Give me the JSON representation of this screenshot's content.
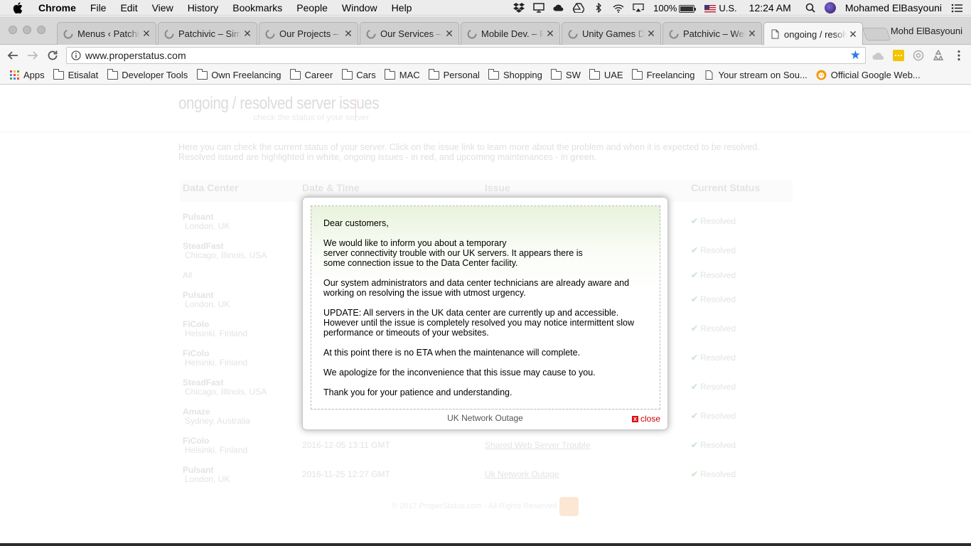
{
  "menubar": {
    "app_name": "Chrome",
    "menus": [
      "File",
      "Edit",
      "View",
      "History",
      "Bookmarks",
      "People",
      "Window",
      "Help"
    ],
    "battery": "100%",
    "input_source": "U.S.",
    "clock": "12:24 AM",
    "user_name": "Mohamed ElBasyouni"
  },
  "tabs": [
    {
      "label": "Menus ‹ Patchi"
    },
    {
      "label": "Patchivic – Simi"
    },
    {
      "label": "Our Projects – I"
    },
    {
      "label": "Our Services –"
    },
    {
      "label": "Mobile Dev. – P"
    },
    {
      "label": "Unity Games Dc"
    },
    {
      "label": "Patchivic – Wel"
    },
    {
      "label": "ongoing / resolv"
    }
  ],
  "profile_name": "Mohd ElBasyouni",
  "toolbar": {
    "url": "www.properstatus.com"
  },
  "bookmarks": [
    {
      "label": "Apps"
    },
    {
      "label": "Etisalat"
    },
    {
      "label": "Developer Tools"
    },
    {
      "label": "Own Freelancing"
    },
    {
      "label": "Career"
    },
    {
      "label": "Cars"
    },
    {
      "label": "MAC"
    },
    {
      "label": "Personal"
    },
    {
      "label": "Shopping"
    },
    {
      "label": "SW"
    },
    {
      "label": "UAE"
    },
    {
      "label": "Freelancing"
    },
    {
      "label": "Your stream on Sou..."
    },
    {
      "label": "Official Google Web..."
    }
  ],
  "page": {
    "title": "ongoing / resolved server issues",
    "tagline": "check the status of your server",
    "intro_line1": "Here you can check the current status of your server. Click on the issue link to learn more about the problem and when it is expected to be resolved.",
    "intro_line2_a": "Resolved issued are highlighted in ",
    "intro_white": "white",
    "intro_line2_b": ", ongoing issues - in ",
    "intro_red": "red",
    "intro_line2_c": ", and upcoming maintenances - in ",
    "intro_green": "green",
    "intro_line2_d": ".",
    "columns": [
      "Data Center",
      "Date & Time",
      "Issue",
      "Current Status"
    ],
    "rows": [
      {
        "name": "Pulsant",
        "location": "London, UK",
        "datetime": "",
        "issue": "",
        "status": "Resolved"
      },
      {
        "name": "SteadFast",
        "location": "Chicago, Illinois, USA",
        "datetime": "",
        "issue": "",
        "status": "Resolved"
      },
      {
        "name": "All",
        "location": "",
        "datetime": "",
        "issue": "",
        "status": "Resolved"
      },
      {
        "name": "Pulsant",
        "location": "London, UK",
        "datetime": "",
        "issue": "",
        "status": "Resolved"
      },
      {
        "name": "FiColo",
        "location": "Helsinki, Finland",
        "datetime": "",
        "issue": "",
        "status": "Resolved"
      },
      {
        "name": "FiColo",
        "location": "Helsinki, Finland",
        "datetime": "",
        "issue": "",
        "status": "Resolved"
      },
      {
        "name": "SteadFast",
        "location": "Chicago, Illinois, USA",
        "datetime": "",
        "issue": "",
        "status": "Resolved"
      },
      {
        "name": "Amaze",
        "location": "Sydney, Australia",
        "datetime": "",
        "issue": "",
        "status": "Resolved"
      },
      {
        "name": "FiColo",
        "location": "Helsinki, Finland",
        "datetime": "2016-12-05 13:11 GMT",
        "issue": "Shared Web Server Trouble",
        "status": "Resolved"
      },
      {
        "name": "Pulsant",
        "location": "London, UK",
        "datetime": "2016-11-25 12:27 GMT",
        "issue": "Uk Network Outage",
        "status": "Resolved"
      }
    ],
    "footer": "© 2017 ProperStatus.com - All Rights Reserved"
  },
  "modal": {
    "lines": [
      "Dear customers,",
      "We would like to inform you about a temporary",
      "server connectivity trouble with our UK servers. It appears there is",
      "some connection issue to the Data Center facility.",
      "Our system administrators and data center technicians are already aware and",
      "working on resolving the issue with utmost urgency.",
      "UPDATE: All servers in the UK data center are currently up and accessible.",
      "However until the issue is completely resolved you may notice intermittent slow",
      "performance or timeouts of your websites.",
      "At this point there is no ETA when the maintenance will complete.",
      "We apologize for the inconvenience that this issue may cause to you.",
      "Thank you for your patience and understanding."
    ],
    "caption": "UK Network Outage",
    "close_label": "close",
    "close_glyph": "x"
  },
  "colors": {
    "modal_gradient_top": "#e8f3dc",
    "close_red": "#cc0000",
    "star_blue": "#2f7ae5"
  }
}
